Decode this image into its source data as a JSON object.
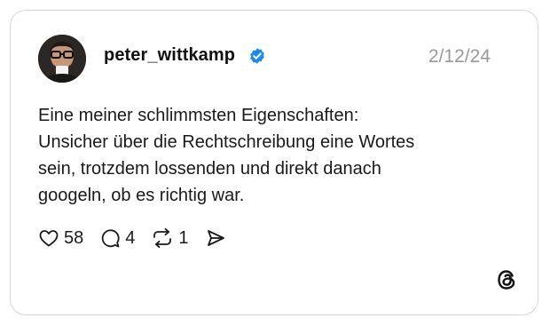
{
  "post": {
    "username": "peter_wittkamp",
    "verified": true,
    "date": "2/12/24",
    "text_lines": [
      "Eine meiner schlimmsten Eigenschaften:",
      "Unsicher über die Rechtschreibung eine Wortes",
      "sein, trotzdem lossenden und direkt danach",
      "googeln, ob es richtig war."
    ],
    "actions": {
      "likes": "58",
      "replies": "4",
      "reposts": "1"
    }
  },
  "icons": {
    "like": "heart-icon",
    "reply": "comment-icon",
    "repost": "repost-icon",
    "share": "send-icon",
    "verified": "verified-badge-icon",
    "brand": "threads-logo-icon"
  },
  "colors": {
    "verified_blue": "#1a8cf0",
    "date_gray": "#9a9a9a",
    "text": "#1a1a1a"
  }
}
